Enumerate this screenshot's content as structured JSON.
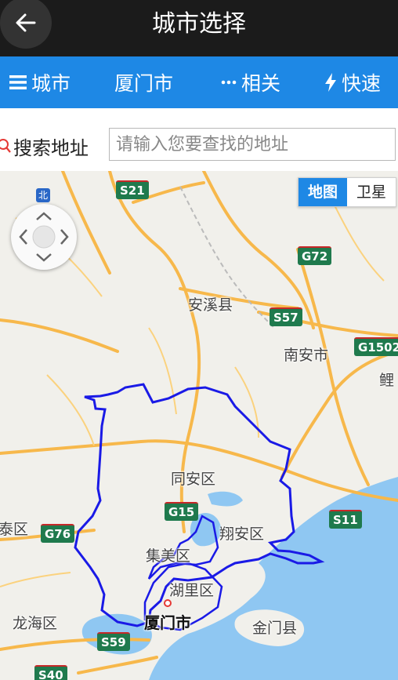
{
  "header": {
    "title": "城市选择",
    "back_icon": "arrow-left-icon"
  },
  "nav": {
    "city_label": "城市",
    "current_city": "厦门市",
    "related_label": "相关",
    "quick_label": "快速"
  },
  "search": {
    "label": "搜索地址",
    "placeholder": "请输入您要查找的地址",
    "value": ""
  },
  "map": {
    "type_map": "地图",
    "type_satellite": "卫星",
    "compass": "北",
    "places": {
      "anxi": "安溪县",
      "nanan": "南安市",
      "li": "鲤",
      "tongan": "同安区",
      "xiangan": "翔安区",
      "jimei": "集美区",
      "huli": "湖里区",
      "xiamen": "厦门市",
      "jinmen": "金门县",
      "longhai": "龙海区",
      "changtai": "泰区"
    },
    "highways": {
      "s21": "S21",
      "g72": "G72",
      "s57": "S57",
      "g1502": "G1502",
      "g15": "G15",
      "s11": "S11",
      "g76": "G76",
      "s59": "S59",
      "s40": "S40"
    },
    "colors": {
      "boundary": "#1a1ae6",
      "sea": "#8fc7f2",
      "road": "#f7b84b",
      "accent": "#1e88e5"
    }
  }
}
